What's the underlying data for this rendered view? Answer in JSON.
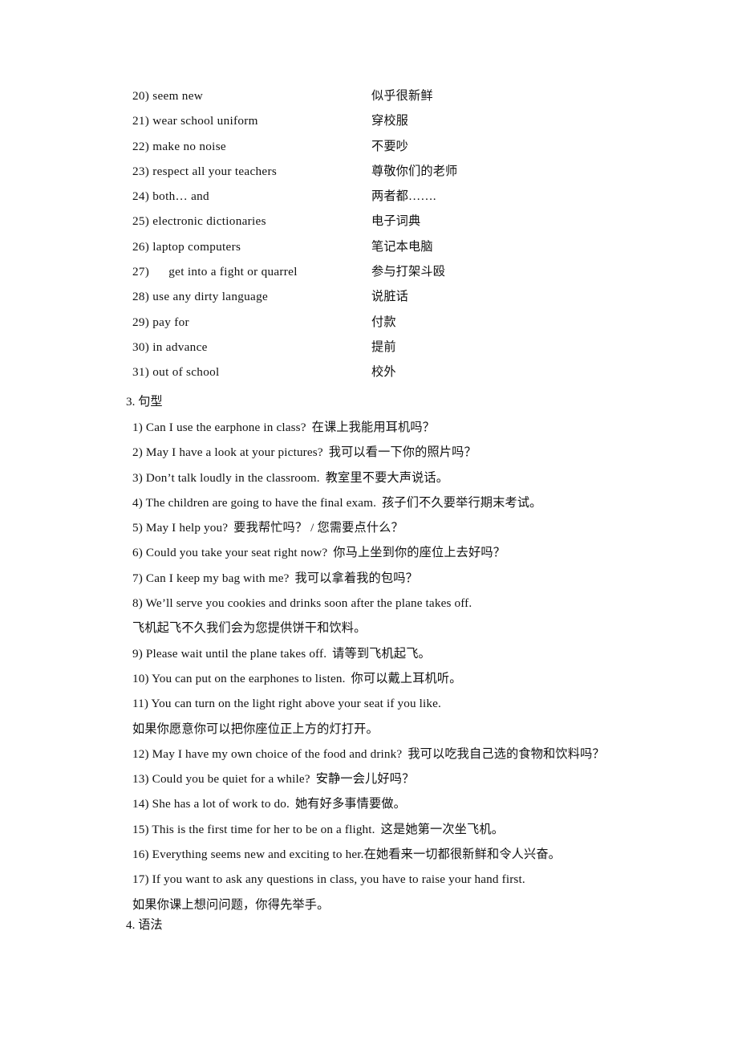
{
  "document": {
    "page_background": "#ffffff",
    "text_color": "#111111"
  },
  "vocabulary": {
    "items": [
      {
        "num": "20)",
        "en": "seem new",
        "zh": "似乎很新鲜",
        "indent": false
      },
      {
        "num": "21)",
        "en": "wear school uniform",
        "zh": "穿校服",
        "indent": false
      },
      {
        "num": "22)",
        "en": "make no noise",
        "zh": "不要吵",
        "indent": false
      },
      {
        "num": "23)",
        "en": "respect all your teachers",
        "zh": "尊敬你们的老师",
        "indent": false
      },
      {
        "num": "24)",
        "en": "both… and",
        "zh": "两者都…….",
        "indent": false
      },
      {
        "num": "25)",
        "en": "electronic dictionaries",
        "zh": "电子词典",
        "indent": false
      },
      {
        "num": "26)",
        "en": "laptop computers",
        "zh": "笔记本电脑",
        "indent": false
      },
      {
        "num": "27)",
        "en": "get into a fight or quarrel",
        "zh": "参与打架斗殴",
        "indent": true
      },
      {
        "num": "28)",
        "en": "use any dirty language",
        "zh": "说脏话",
        "indent": false
      },
      {
        "num": "29)",
        "en": "pay for",
        "zh": "付款",
        "indent": false
      },
      {
        "num": "30)",
        "en": "in advance",
        "zh": "提前",
        "indent": false
      },
      {
        "num": "31)",
        "en": "out of school",
        "zh": "校外",
        "indent": false
      }
    ]
  },
  "section_sentence_patterns": {
    "heading": "3. 句型",
    "items": [
      {
        "num": "1)",
        "en": "Can I use the earphone in class?",
        "zh": "在课上我能用耳机吗？",
        "wrap": false,
        "tight": false
      },
      {
        "num": "2)",
        "en": "May I have a look at your pictures?",
        "zh": "我可以看一下你的照片吗？",
        "wrap": false,
        "tight": false
      },
      {
        "num": "3)",
        "en": "Don’t talk loudly in the classroom.",
        "zh": "教室里不要大声说话。",
        "wrap": false,
        "tight": false
      },
      {
        "num": "4)",
        "en": "The children are going to have the final exam.",
        "zh": "孩子们不久要举行期末考试。",
        "wrap": false,
        "tight": false
      },
      {
        "num": "5)",
        "en": "May I help you?",
        "zh": "要我帮忙吗？ / 您需要点什么？",
        "wrap": false,
        "tight": false
      },
      {
        "num": "6)",
        "en": "Could you take your seat right now?",
        "zh": "你马上坐到你的座位上去好吗？",
        "wrap": false,
        "tight": false
      },
      {
        "num": "7)",
        "en": "Can I keep my bag with me?",
        "zh": "我可以拿着我的包吗？",
        "wrap": false,
        "tight": false
      },
      {
        "num": "8)",
        "en": "We’ll serve you cookies and drinks soon after the plane takes off.",
        "zh": "飞机起飞不久我们会为您提供饼干和饮料。",
        "wrap": true,
        "tight": false
      },
      {
        "num": "9)",
        "en": "Please wait until the plane takes off.",
        "zh": "请等到飞机起飞。",
        "wrap": false,
        "tight": false
      },
      {
        "num": "10)",
        "en": "You can put on the earphones to listen.",
        "zh": "你可以戴上耳机听。",
        "wrap": false,
        "tight": false
      },
      {
        "num": "11)",
        "en": "You can turn on the light right above your seat if you like.",
        "zh": "如果你愿意你可以把你座位正上方的灯打开。",
        "wrap": true,
        "tight": false
      },
      {
        "num": "12)",
        "en": "May I have my own choice of the food and drink?",
        "zh": "我可以吃我自己选的食物和饮料吗？",
        "wrap": false,
        "tight": false
      },
      {
        "num": "13)",
        "en": "Could you be quiet for a while?",
        "zh": "安静一会儿好吗？",
        "wrap": false,
        "tight": false
      },
      {
        "num": "14)",
        "en": "She has a lot of work to do.",
        "zh": "她有好多事情要做。",
        "wrap": false,
        "tight": false
      },
      {
        "num": "15)",
        "en": "This is the first time for her to be on a flight.",
        "zh": "这是她第一次坐飞机。",
        "wrap": false,
        "tight": false
      },
      {
        "num": "16)",
        "en": "Everything seems new and exciting to her.",
        "zh": "在她看来一切都很新鲜和令人兴奋。",
        "wrap": false,
        "tight": true
      },
      {
        "num": "17)",
        "en": "If you want to ask any questions in class, you have to raise your hand first.",
        "zh": "如果你课上想问问题，你得先举手。",
        "wrap": true,
        "tight": false
      }
    ]
  },
  "section_grammar": {
    "heading": "4. 语法"
  }
}
